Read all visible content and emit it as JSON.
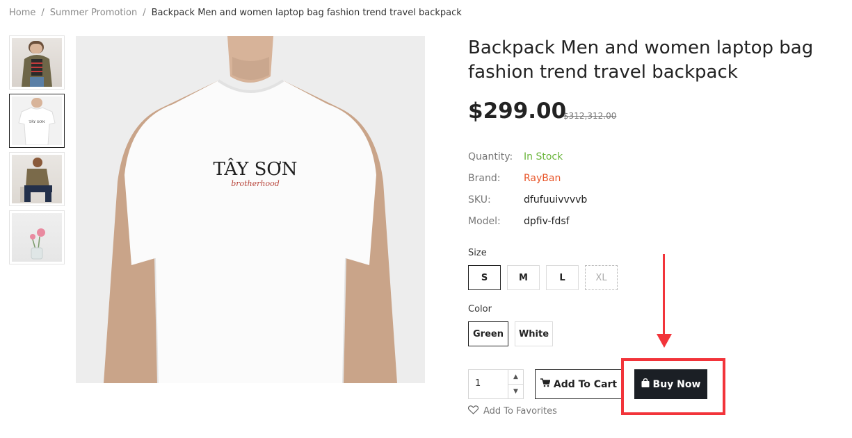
{
  "breadcrumb": {
    "home": "Home",
    "category": "Summer Promotion",
    "current": "Backpack Men and women laptop bag fashion trend travel backpack",
    "separator": "/"
  },
  "product": {
    "title": "Backpack Men and women laptop bag fashion trend travel backpack",
    "price": "$299.00",
    "old_price": "$312,312.00",
    "image_print": {
      "brand": "TÂY SƠN",
      "script": "brotherhood"
    }
  },
  "specs": [
    {
      "key": "Quantity:",
      "value": "In Stock"
    },
    {
      "key": "Brand:",
      "value": "RayBan"
    },
    {
      "key": "SKU:",
      "value": "dfufuuivvvvb"
    },
    {
      "key": "Model:",
      "value": "dpfiv-fdsf"
    }
  ],
  "size": {
    "label": "Size",
    "options": [
      "S",
      "M",
      "L",
      "XL"
    ],
    "selected": "S",
    "disabled": [
      "XL"
    ]
  },
  "color": {
    "label": "Color",
    "options": [
      "Green",
      "White"
    ],
    "selected": "Green"
  },
  "cart": {
    "quantity": "1",
    "add_to_cart": "Add To Cart",
    "buy_now": "Buy Now",
    "favorites": "Add To Favorites"
  },
  "colors": {
    "in_stock": "#6ab53b",
    "brand": "#e8562a",
    "buy_now_bg": "#1b1f25",
    "annotation": "#f2343a"
  }
}
